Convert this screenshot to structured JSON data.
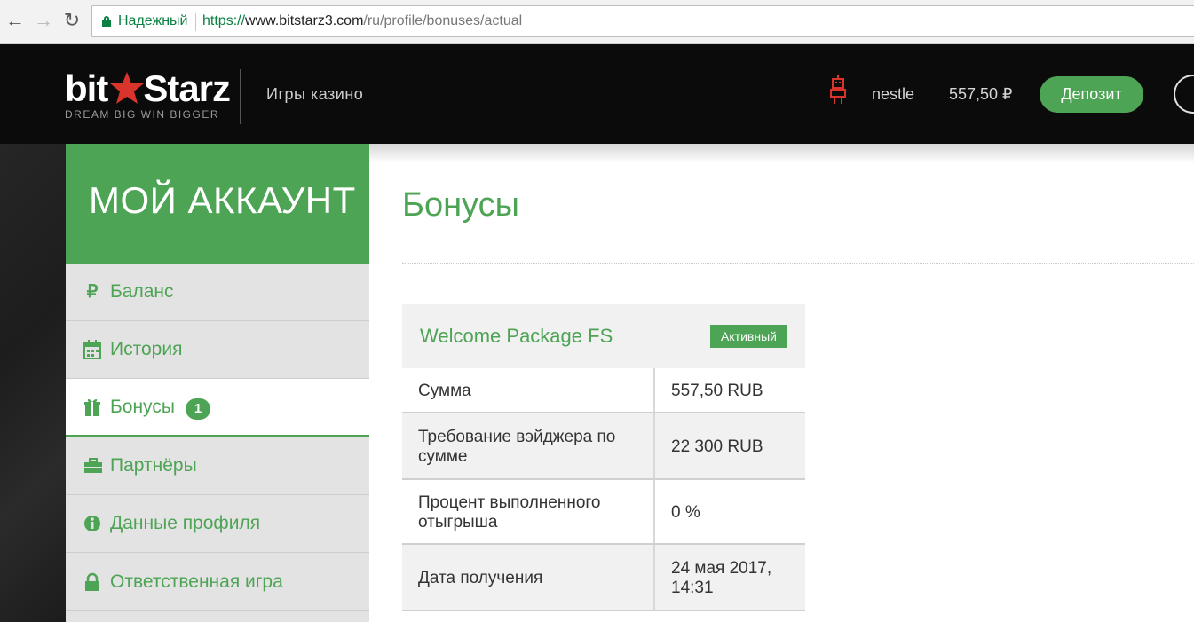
{
  "browser": {
    "secure_label": "Надежный",
    "url_scheme": "https://",
    "url_host": "www.bitstarz3.com",
    "url_path": "/ru/profile/bonuses/actual"
  },
  "header": {
    "logo_text_left": "bit",
    "logo_text_right": "Starz",
    "logo_tagline": "DREAM BIG  WIN BIGGER",
    "games_link": "Игры казино",
    "username": "nestle",
    "balance": "557,50 ₽",
    "deposit_label": "Депозит",
    "brand_color": "#4ea455",
    "star_color": "#d9342b"
  },
  "sidebar": {
    "title": "МОЙ АККАУНТ",
    "items": [
      {
        "label": "Баланс",
        "icon": "ruble-icon"
      },
      {
        "label": "История",
        "icon": "calendar-icon"
      },
      {
        "label": "Бонусы",
        "icon": "gift-icon",
        "badge": "1",
        "active": true
      },
      {
        "label": "Партнёры",
        "icon": "briefcase-icon"
      },
      {
        "label": "Данные профиля",
        "icon": "info-icon"
      },
      {
        "label": "Ответственная игра",
        "icon": "lock-icon"
      }
    ]
  },
  "main": {
    "title": "Бонусы",
    "bonus": {
      "name": "Welcome Package FS",
      "status": "Активный",
      "rows": [
        {
          "label": "Сумма",
          "value": "557,50 RUB"
        },
        {
          "label": "Требование вэйджера по сумме",
          "value": "22 300 RUB"
        },
        {
          "label": "Процент выполненного отыгрыша",
          "value": "0 %"
        },
        {
          "label": "Дата получения",
          "value": "24 мая 2017, 14:31"
        }
      ]
    }
  }
}
